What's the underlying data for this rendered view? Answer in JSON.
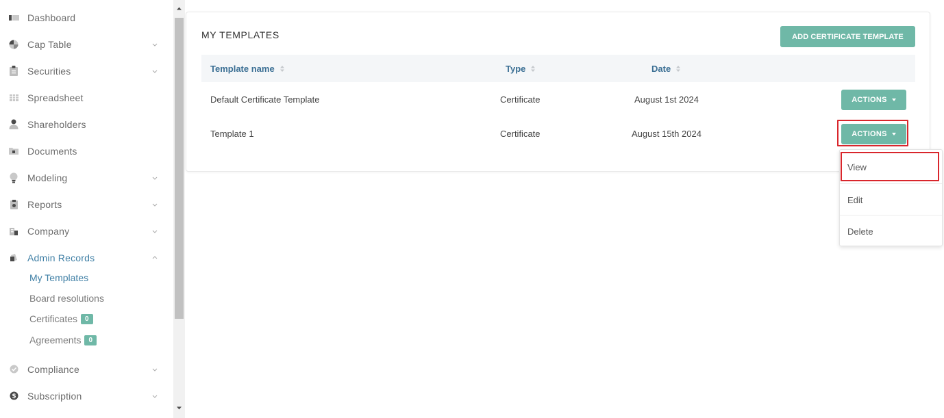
{
  "sidebar": {
    "items": [
      {
        "label": "Dashboard",
        "icon": "dashboard-icon",
        "chevron": ""
      },
      {
        "label": "Cap Table",
        "icon": "pie-chart-icon",
        "chevron": "down"
      },
      {
        "label": "Securities",
        "icon": "clipboard-icon",
        "chevron": "down"
      },
      {
        "label": "Spreadsheet",
        "icon": "spreadsheet-icon",
        "chevron": ""
      },
      {
        "label": "Shareholders",
        "icon": "person-icon",
        "chevron": ""
      },
      {
        "label": "Documents",
        "icon": "folder-icon",
        "chevron": ""
      },
      {
        "label": "Modeling",
        "icon": "lightbulb-icon",
        "chevron": "down"
      },
      {
        "label": "Reports",
        "icon": "report-icon",
        "chevron": "down"
      },
      {
        "label": "Company",
        "icon": "building-icon",
        "chevron": "down"
      },
      {
        "label": "Admin Records",
        "icon": "admin-records-icon",
        "chevron": "up"
      }
    ],
    "sub_items": [
      {
        "label": "My Templates",
        "badge": ""
      },
      {
        "label": "Board resolutions",
        "badge": ""
      },
      {
        "label": "Certificates",
        "badge": "0"
      },
      {
        "label": "Agreements",
        "badge": "0"
      }
    ],
    "bottom_items": [
      {
        "label": "Compliance",
        "icon": "shield-check-icon",
        "chevron": "down"
      },
      {
        "label": "Subscription",
        "icon": "dollar-coin-icon",
        "chevron": "down"
      }
    ]
  },
  "card": {
    "title": "MY TEMPLATES",
    "add_button": "ADD CERTIFICATE TEMPLATE",
    "columns": [
      "Template name",
      "Type",
      "Date"
    ],
    "rows": [
      {
        "name": "Default Certificate Template",
        "type": "Certificate",
        "date": "August 1st 2024",
        "action": "ACTIONS"
      },
      {
        "name": "Template 1",
        "type": "Certificate",
        "date": "August 15th 2024",
        "action": "ACTIONS"
      }
    ]
  },
  "dropdown": {
    "items": [
      "View",
      "Edit",
      "Delete"
    ]
  },
  "colors": {
    "accent": "#6fb8a7",
    "active_text": "#3f7fa5",
    "highlight": "#d9262c"
  }
}
